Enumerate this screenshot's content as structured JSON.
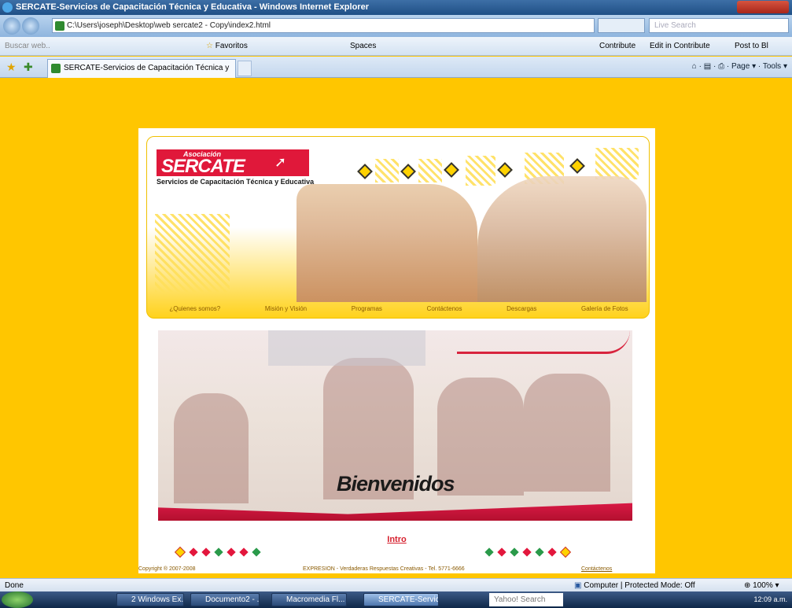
{
  "window": {
    "title": "SERCATE-Servicios de Capacitación Técnica y Educativa - Windows Internet Explorer"
  },
  "toolbar": {
    "address": "C:\\Users\\joseph\\Desktop\\web sercate2 - Copy\\index2.html",
    "live_search_placeholder": "Live Search",
    "buscar_placeholder": "Buscar web..",
    "favorites_label": "Favoritos",
    "spaces_label": "Spaces",
    "contribute_label": "Contribute",
    "edit_in_contribute_label": "Edit in Contribute",
    "post_to_blog_label": "Post to Bl"
  },
  "tabs": {
    "active_tab": "SERCATE-Servicios de Capacitación Técnica y Ed...",
    "page_label": "Page",
    "tools_label": "Tools"
  },
  "site": {
    "logo_small": "Asociación",
    "logo_big": "SERCATE",
    "logo_tagline": "Servicios de Capacitación Técnica y Educativa",
    "nav": [
      "¿Quienes somos?",
      "Misión y Visión",
      "Programas",
      "Contáctenos",
      "Descargas",
      "Galería de Fotos"
    ],
    "welcome": "Bienvenidos",
    "intro_link": "Intro",
    "copyright": "Copyright ® 2007-2008",
    "credits": "EXPRESION - Verdaderas Respuestas Creativas - Tel. 5771-6666",
    "contact_link": "Contáctenos"
  },
  "status": {
    "left": "Done",
    "zone": "Computer | Protected Mode: Off",
    "zoom": "100%"
  },
  "taskbar": {
    "items": [
      "2 Windows Ex...",
      "Documento2 - ...",
      "Macromedia Fl...",
      "SERCATE-Servic..."
    ],
    "search": "Yahoo! Search",
    "clock": "12:09 a.m."
  }
}
